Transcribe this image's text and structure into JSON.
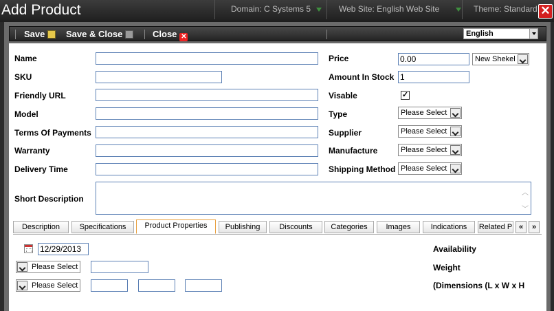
{
  "window": {
    "title": "Add Product"
  },
  "topbar": {
    "domain": "Domain: C Systems 5",
    "website": "Web Site: English Web Site",
    "theme": "Theme: Standard"
  },
  "toolbar": {
    "save_label": "Save",
    "save_close_label": "Save & Close",
    "close_label": "Close",
    "language": "English"
  },
  "form": {
    "left": {
      "name_label": "Name",
      "sku_label": "SKU",
      "friendly_url_label": "Friendly URL",
      "model_label": "Model",
      "terms_label": "Terms Of Payments",
      "warranty_label": "Warranty",
      "delivery_label": "Delivery Time",
      "short_desc_label": "Short Description"
    },
    "right": {
      "price_label": "Price",
      "price_value": "0.00",
      "currency": "New Shekel",
      "stock_label": "Amount In Stock",
      "stock_value": "1",
      "visable_label": "Visable",
      "visable_checked": "✓",
      "type_label": "Type",
      "supplier_label": "Supplier",
      "manufacture_label": "Manufacture",
      "shipping_label": "Shipping Method",
      "select_placeholder": "Please Select"
    }
  },
  "tabs": [
    "Description",
    "Specifications",
    "Product Properties",
    "Publishing",
    "Discounts",
    "Categories",
    "Images",
    "Indications",
    "Related P"
  ],
  "active_tab": "Product Properties",
  "tab_nav": {
    "prev": "«",
    "next": "»"
  },
  "properties": {
    "date_value": "12/29/2013",
    "availability_label": "Availability",
    "weight_label": "Weight",
    "dimensions_label": "(Dimensions (L x W x H",
    "select_placeholder": "Please Select"
  },
  "colors": {
    "close_red": "#d42020",
    "input_border": "#5a7fb4",
    "active_tab_border": "#e8a040"
  }
}
